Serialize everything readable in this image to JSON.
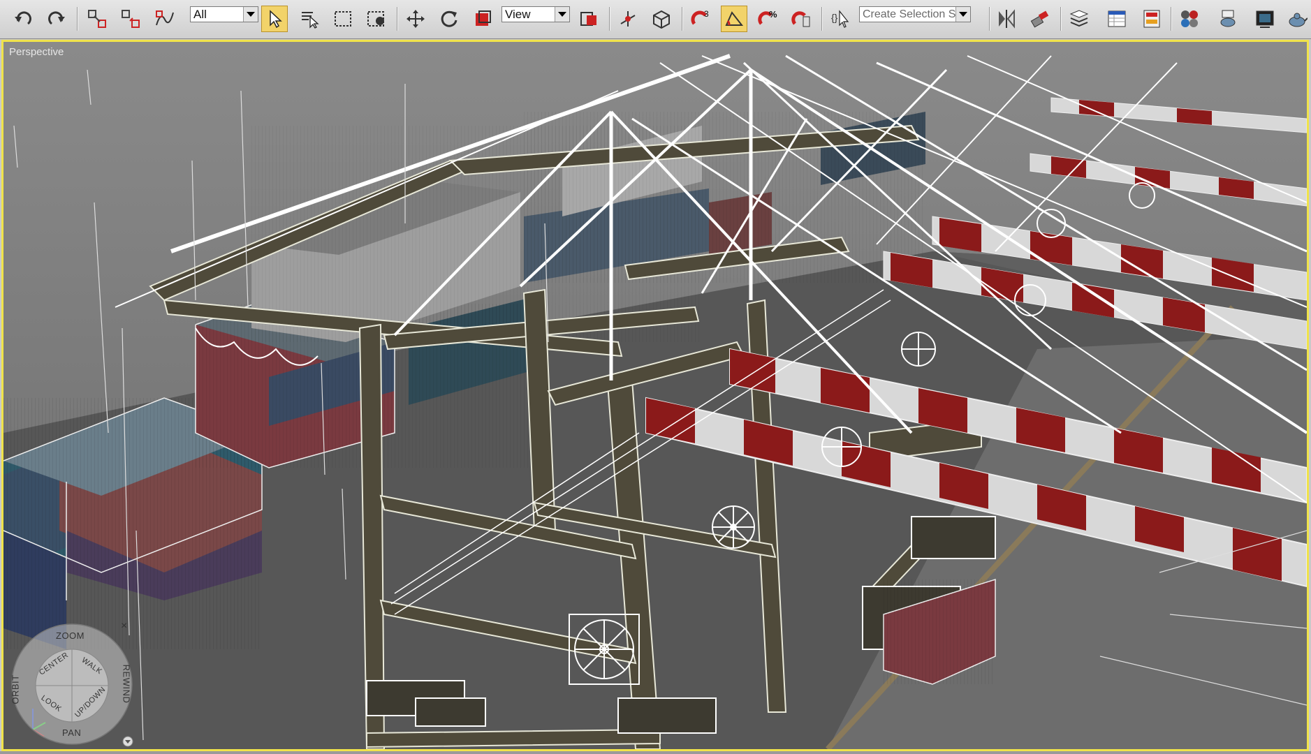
{
  "toolbar": {
    "selection_filter": "All",
    "reference_coord": "View",
    "named_selection_placeholder": "Create Selection Set",
    "angle_snap_label": "3",
    "percent_snap_label": "%",
    "icons": [
      "undo-icon",
      "redo-icon",
      "select-and-link-icon",
      "unlink-selection-icon",
      "bind-to-space-warp-icon",
      "select-object-icon",
      "select-by-name-icon",
      "rectangular-region-icon",
      "window-crossing-icon",
      "select-and-move-icon",
      "select-and-rotate-icon",
      "select-and-scale-icon",
      "use-pivot-center-icon",
      "select-and-manipulate-icon",
      "keyboard-shortcut-override-icon",
      "snaps-toggle-icon",
      "angle-snap-icon",
      "percent-snap-icon",
      "spinner-snap-icon",
      "edit-named-selection-icon",
      "mirror-icon",
      "align-icon",
      "layer-manager-icon",
      "curve-editor-icon",
      "schematic-view-icon",
      "material-editor-icon",
      "render-setup-icon",
      "rendered-frame-window-icon",
      "render-production-icon"
    ],
    "active_color": "#f2d36a"
  },
  "viewport": {
    "label": "Perspective",
    "active_border_color": "#f0e34a"
  },
  "steering_wheel": {
    "zoom": "ZOOM",
    "orbit": "ORBIT",
    "rewind": "REWIND",
    "pan": "PAN",
    "center": "CENTER",
    "walk": "WALK",
    "look": "LOOK",
    "updown": "UP/DOWN",
    "close": "×"
  },
  "colors": {
    "crane_beam_red": "#8b1a1a",
    "crane_beam_white": "#d8d8d8",
    "frame_olive": "#4f4a3a",
    "ground": "#5f5f5f"
  }
}
